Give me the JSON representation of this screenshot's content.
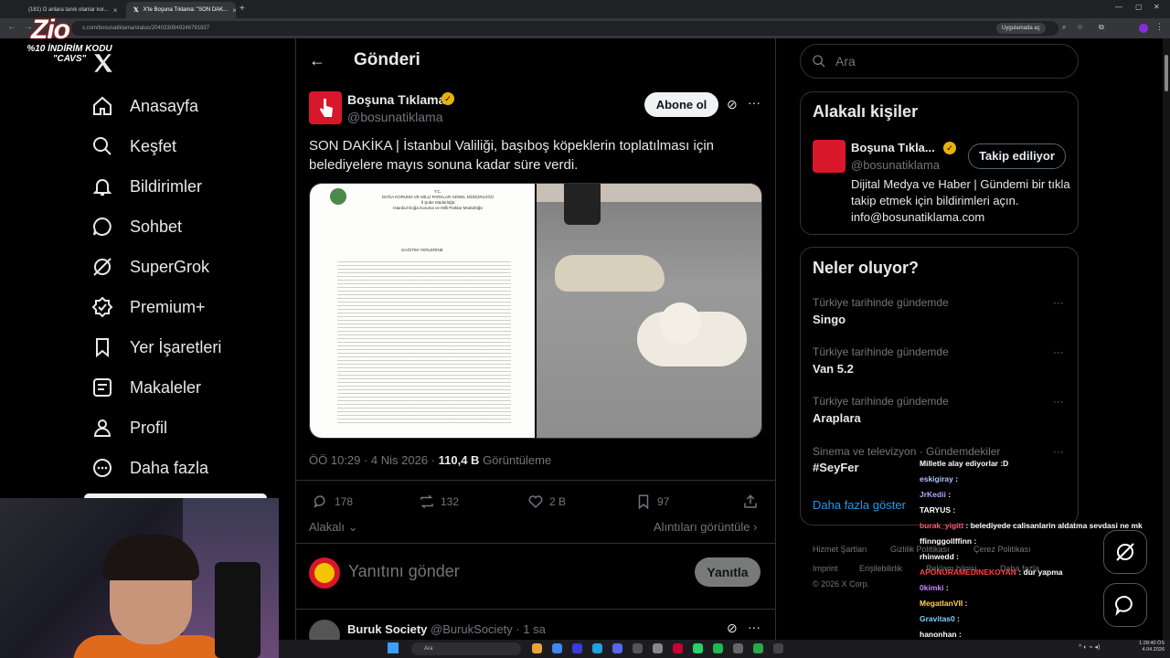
{
  "browser": {
    "tabs": [
      {
        "label": "(181) O anlara tanık olanlar kor..."
      },
      {
        "label": "X'te Boşuna Tıklama: \"SON DAK..."
      }
    ],
    "url": "x.com/bosunatiklama/status/2040330949246791837",
    "open_in_app": "Uygulamada aç"
  },
  "overlay": {
    "logo": "Zio",
    "promo_line1": "%10 İNDİRİM KODU",
    "promo_line2": "\"CAVS\""
  },
  "nav": {
    "items": [
      {
        "label": "Anasayfa",
        "icon": "home-icon"
      },
      {
        "label": "Keşfet",
        "icon": "search-icon"
      },
      {
        "label": "Bildirimler",
        "icon": "bell-icon"
      },
      {
        "label": "Sohbet",
        "icon": "chat-icon"
      },
      {
        "label": "SuperGrok",
        "icon": "grok-icon"
      },
      {
        "label": "Premium+",
        "icon": "premium-icon"
      },
      {
        "label": "Yer İşaretleri",
        "icon": "bookmark-icon"
      },
      {
        "label": "Makaleler",
        "icon": "article-icon"
      },
      {
        "label": "Profil",
        "icon": "profile-icon"
      },
      {
        "label": "Daha fazla",
        "icon": "more-icon"
      }
    ]
  },
  "post": {
    "header_title": "Gönderi",
    "author_name": "Boşuna Tıklama",
    "author_handle": "@bosunatiklama",
    "subscribe_label": "Abone ol",
    "text": "SON DAKİKA | İstanbul Valiliği, başıboş köpeklerin toplatılması için belediyelere mayıs sonuna kadar süre verdi.",
    "time": "ÖÖ 10:29 · 4 Nis 2026 · ",
    "views_count": "110,4 B",
    "views_label": " Görüntüleme",
    "actions": {
      "replies": "178",
      "reposts": "132",
      "likes": "2 B",
      "bookmarks": "97"
    },
    "sort_label": "Alakalı",
    "quotes_label": "Alıntıları görüntüle",
    "reply_placeholder": "Yanıtını gönder",
    "reply_button": "Yanıtla",
    "document": {
      "header1": "T.C.",
      "header2": "DOĞA KORUMA VE MİLLİ PARKLAR GENEL MÜDÜRLÜĞÜ",
      "header3": "İl Şube Müdürlüğü",
      "header4": "İstanbul Doğa Koruma ve Milli Parklar Müdürlüğü",
      "subtitle": "DAĞITIM YERLERİNE"
    }
  },
  "next_post": {
    "name": "Buruk Society",
    "handle": "@BurukSociety · 1 sa"
  },
  "sidebar": {
    "search_placeholder": "Ara",
    "relevant_title": "Alakalı kişiler",
    "relevant_name": "Boşuna Tıkla...",
    "relevant_handle": "@bosunatiklama",
    "follow_label": "Takip ediliyor",
    "relevant_bio": "Dijital Medya ve Haber | Gündemi bir tıkla takip etmek için bildirimleri açın. info@bosunatiklama.com",
    "trends_title": "Neler oluyor?",
    "trends": [
      {
        "context": "Türkiye tarihinde gündemde",
        "name": "Singo"
      },
      {
        "context": "Türkiye tarihinde gündemde",
        "name": "Van 5.2"
      },
      {
        "context": "Türkiye tarihinde gündemde",
        "name": "Araplara"
      },
      {
        "context": "Sinema ve televizyon · Gündemdekiler",
        "name": "#SeyFer"
      }
    ],
    "show_more": "Daha fazla göster",
    "footer": [
      "Hizmet Şartları",
      "Gizlilik Politikası",
      "Çerez Politikası",
      "Imprint",
      "Erişilebilirlik",
      "Reklam bilgisi",
      "Daha fazla ...",
      "© 2026 X Corp."
    ]
  },
  "chat": [
    {
      "user": "",
      "msg": "Milletle alay ediyorlar :D",
      "color": "#ffffff"
    },
    {
      "user": "eskigiray",
      "msg": ":",
      "color": "#a7c7ff"
    },
    {
      "user": "JrKedii",
      "msg": ":",
      "color": "#b7a6ff"
    },
    {
      "user": "TARYUS",
      "msg": ":",
      "color": "#ffffff"
    },
    {
      "user": "burak_yigitt",
      "msg": ": belediyede calisanlarin aldatma sevdasi ne mk",
      "color": "#ff5a6e"
    },
    {
      "user": "ffinnggollffinn",
      "msg": ":",
      "color": "#ffffff"
    },
    {
      "user": "rhinwedd",
      "msg": ":",
      "color": "#ffffff"
    },
    {
      "user": "APONURAMEDINEKOYAN",
      "msg": ": dur yapma",
      "color": "#ff4040"
    },
    {
      "user": "0kimki",
      "msg": ":",
      "color": "#c58bff"
    },
    {
      "user": "MegatlanVII",
      "msg": ":",
      "color": "#ffd35a"
    },
    {
      "user": "Gravitas0",
      "msg": ":",
      "color": "#7fd0ff"
    },
    {
      "user": "hanonhan",
      "msg": ":",
      "color": "#ffffff"
    }
  ],
  "taskbar": {
    "search": "Ara",
    "time": "1:28:40 ÖS",
    "date": "4.04.2026"
  }
}
